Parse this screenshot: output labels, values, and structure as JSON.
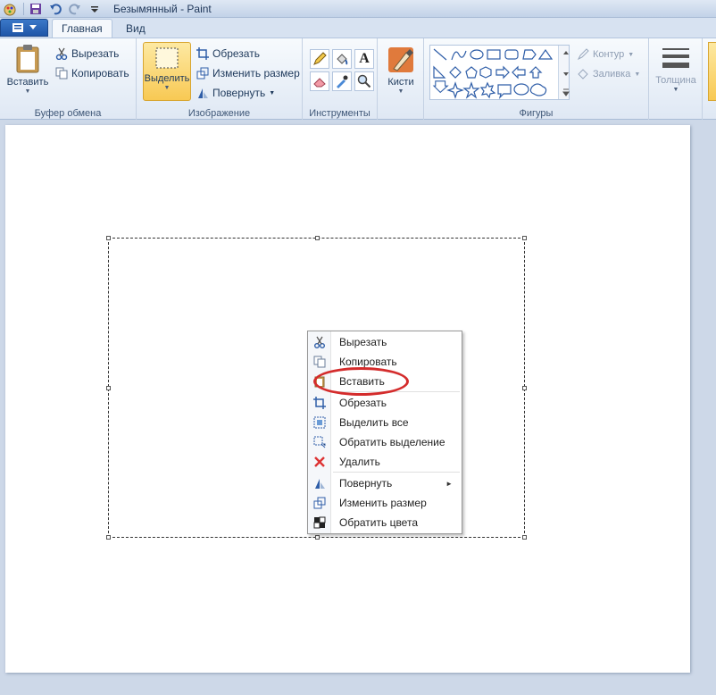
{
  "window": {
    "title": "Безымянный - Paint"
  },
  "qat": {
    "icons": [
      "paint-app-icon",
      "save-icon",
      "undo-icon",
      "redo-icon",
      "qat-dropdown-icon"
    ]
  },
  "tabs": [
    {
      "label": "Главная"
    },
    {
      "label": "Вид"
    }
  ],
  "ribbon": {
    "clipboard": {
      "label": "Буфер обмена",
      "paste": "Вставить",
      "cut": "Вырезать",
      "copy": "Копировать"
    },
    "image": {
      "label": "Изображение",
      "select": "Выделить",
      "crop": "Обрезать",
      "resize": "Изменить размер",
      "rotate": "Повернуть"
    },
    "tools": {
      "label": "Инструменты"
    },
    "brushes": {
      "label": "Кисти"
    },
    "shapes": {
      "label": "Фигуры",
      "outline": "Контур",
      "fill": "Заливка"
    },
    "size": {
      "label": "Толщина"
    }
  },
  "context_menu": {
    "items": [
      {
        "label": "Вырезать",
        "icon": "scissors-icon"
      },
      {
        "label": "Копировать",
        "icon": "copy-icon"
      },
      {
        "label": "Вставить",
        "icon": "paste-icon"
      },
      {
        "label": "Обрезать",
        "icon": "crop-icon"
      },
      {
        "label": "Выделить все",
        "icon": "select-all-icon"
      },
      {
        "label": "Обратить выделение",
        "icon": "invert-selection-icon"
      },
      {
        "label": "Удалить",
        "icon": "delete-icon"
      },
      {
        "label": "Повернуть",
        "icon": "rotate-icon"
      },
      {
        "label": "Изменить размер",
        "icon": "resize-icon"
      },
      {
        "label": "Обратить цвета",
        "icon": "invert-colors-icon"
      }
    ],
    "highlighted_item": "Вставить"
  },
  "colors": {
    "highlight_ellipse": "#d42c2c",
    "select_active": "#f8c954",
    "file_button": "#1f56a8"
  }
}
